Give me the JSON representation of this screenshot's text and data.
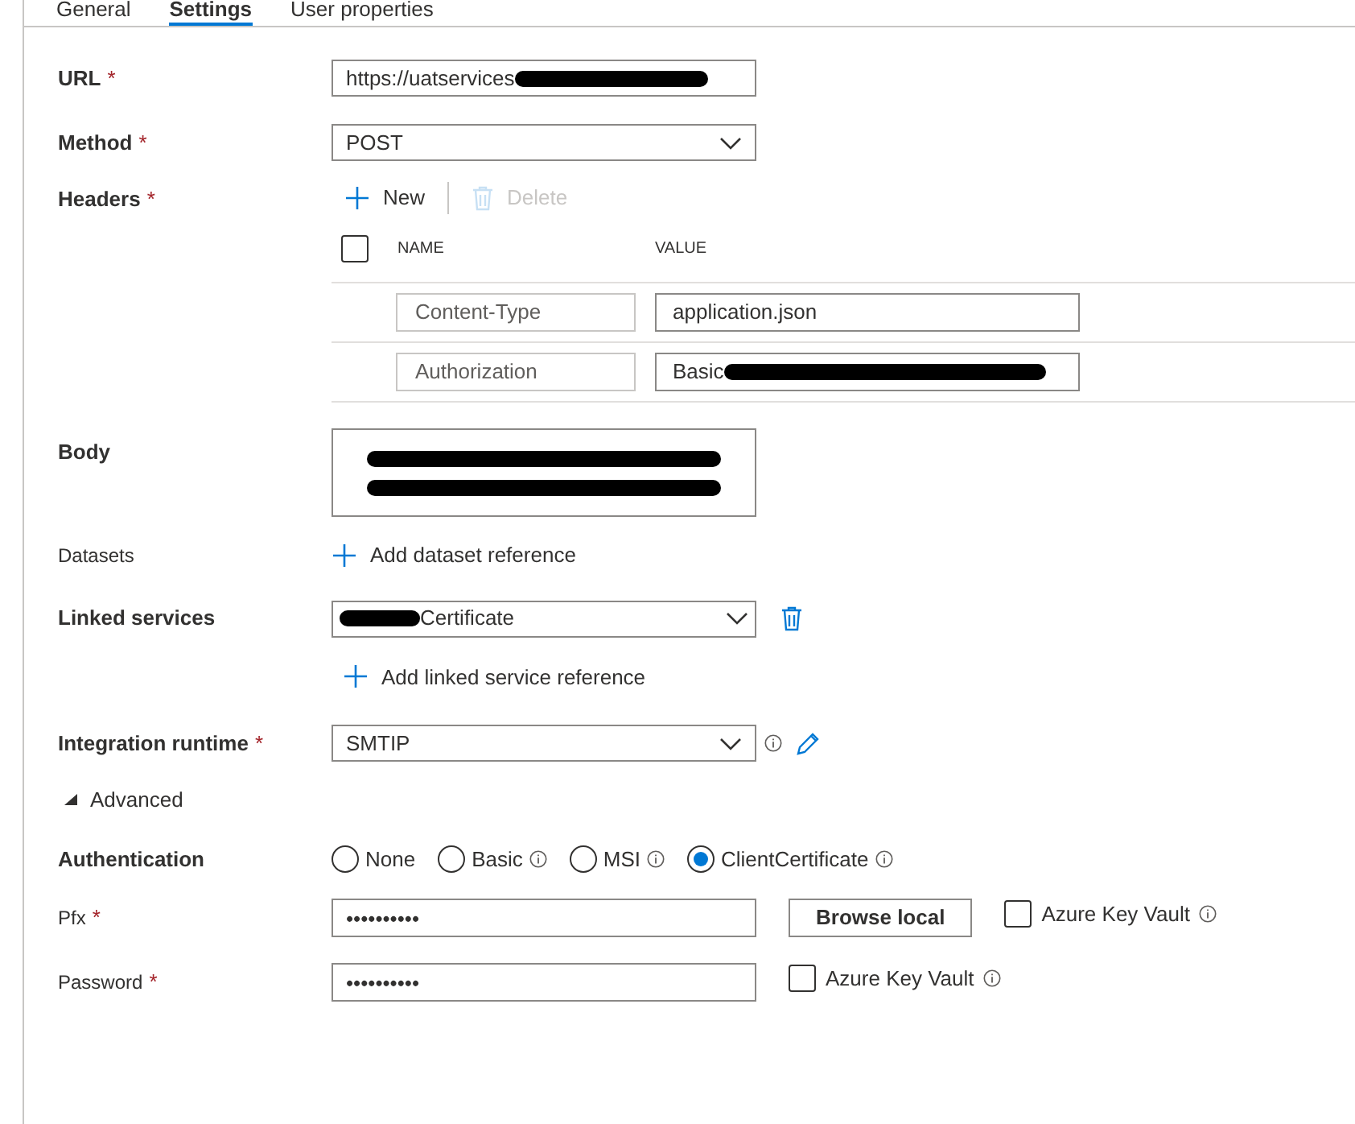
{
  "tabs": [
    {
      "label": "General",
      "selected": false
    },
    {
      "label": "Settings",
      "selected": true
    },
    {
      "label": "User properties",
      "selected": false
    }
  ],
  "url": {
    "label": "URL",
    "required_mark": "*",
    "value": "https://uatservices",
    "redacted": true
  },
  "method": {
    "label": "Method",
    "required_mark": "*",
    "value": "POST"
  },
  "headers": {
    "label": "Headers",
    "required_mark": "*",
    "new_label": "New",
    "delete_label": "Delete",
    "delete_disabled": true,
    "select_all_checked": false,
    "columns": [
      "NAME",
      "VALUE"
    ],
    "rows": [
      {
        "name": "Content-Type",
        "value": "application.json",
        "redacted": false
      },
      {
        "name": "Authorization",
        "value": "Basic",
        "redacted": true
      }
    ]
  },
  "body": {
    "label": "Body",
    "redacted": true
  },
  "datasets": {
    "label": "Datasets",
    "add_label": "Add dataset reference"
  },
  "linked_services": {
    "label": "Linked services",
    "value": "Certificate",
    "add_label": "Add linked service reference"
  },
  "integration_runtime": {
    "label": "Integration runtime",
    "required_mark": "*",
    "value": "SMTIP"
  },
  "advanced": {
    "label": "Advanced",
    "expanded": true
  },
  "authentication": {
    "label": "Authentication",
    "options": [
      {
        "label": "None",
        "selected": false,
        "info": false
      },
      {
        "label": "Basic",
        "selected": false,
        "info": true
      },
      {
        "label": "MSI",
        "selected": false,
        "info": true
      },
      {
        "label": "ClientCertificate",
        "selected": true,
        "info": true
      }
    ]
  },
  "pfx": {
    "label": "Pfx",
    "required_mark": "*",
    "value": "••••••••••",
    "browse_label": "Browse local",
    "key_vault": {
      "label": "Azure Key Vault",
      "checked": false
    }
  },
  "password": {
    "label": "Password",
    "required_mark": "*",
    "value": "••••••••••",
    "key_vault": {
      "label": "Azure Key Vault",
      "checked": false
    }
  }
}
